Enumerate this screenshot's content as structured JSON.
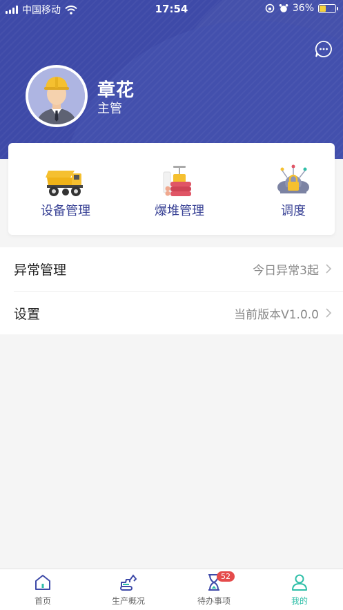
{
  "status_bar": {
    "carrier": "中国移动",
    "time": "17:54",
    "battery": "36%",
    "battery_level": 0.36
  },
  "profile": {
    "name": "章花",
    "role": "主管"
  },
  "quick_actions": [
    {
      "label": "设备管理",
      "icon": "dump-truck-icon"
    },
    {
      "label": "爆堆管理",
      "icon": "explosive-pile-icon"
    },
    {
      "label": "调度",
      "icon": "dispatch-cloud-icon"
    }
  ],
  "menu": [
    {
      "title": "异常管理",
      "value": "今日异常3起"
    },
    {
      "title": "设置",
      "value": "当前版本V1.0.0"
    }
  ],
  "tabbar": {
    "tabs": [
      {
        "label": "首页",
        "icon": "home-icon"
      },
      {
        "label": "生产概况",
        "icon": "excavator-icon"
      },
      {
        "label": "待办事项",
        "icon": "hourglass-icon"
      },
      {
        "label": "我的",
        "icon": "person-icon"
      }
    ],
    "todo_badge": "52",
    "active_tab": "我的"
  },
  "colors": {
    "header": "#3e4aa8",
    "accent_text": "#3a4396",
    "active_tab": "#2fbfa8",
    "badge": "#e54b4b"
  }
}
